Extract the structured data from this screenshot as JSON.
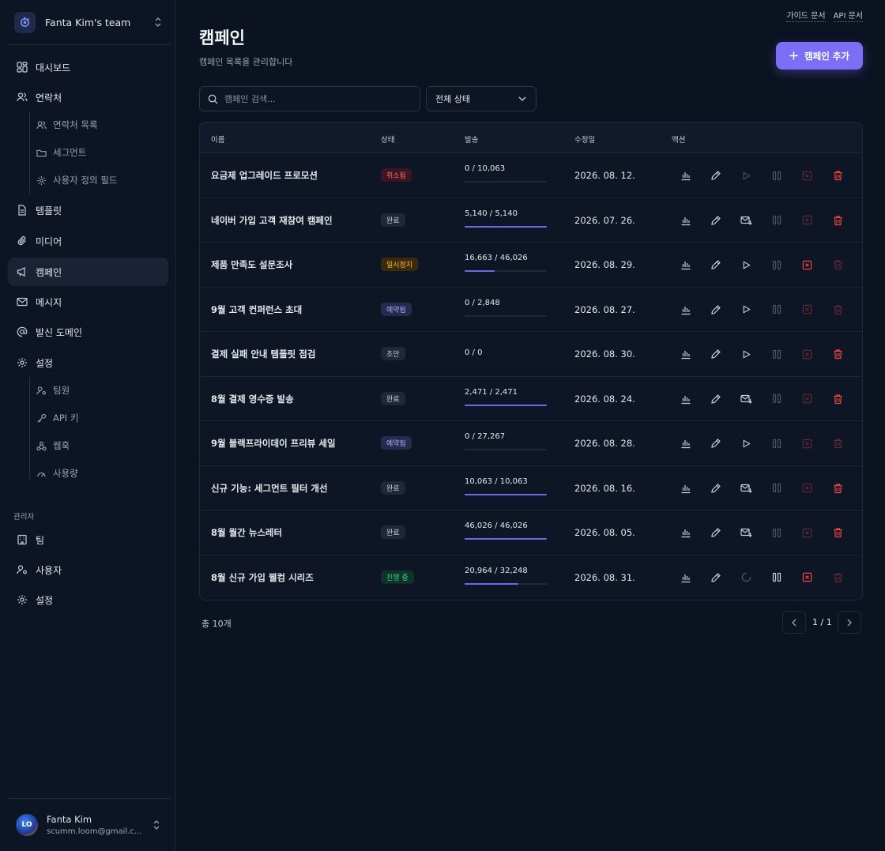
{
  "team": {
    "name": "Fanta Kim's team"
  },
  "nav": {
    "dashboard": "대시보드",
    "contacts": "연락처",
    "contacts_list": "연락처 목록",
    "segments": "세그먼트",
    "custom_fields": "사용자 정의 필드",
    "templates": "템플릿",
    "media": "미디어",
    "campaigns": "캠페인",
    "messages": "메시지",
    "domains": "발신 도메인",
    "settings": "설정",
    "members": "팀원",
    "api_keys": "API 키",
    "webhooks": "웹훅",
    "usage": "사용량"
  },
  "admin": {
    "label": "관리자",
    "teams": "팀",
    "users": "사용자",
    "settings": "설정"
  },
  "user": {
    "name": "Fanta Kim",
    "email": "scumm.loom@gmail.c...",
    "avatar_text": "LO"
  },
  "top_links": {
    "guide": "가이드 문서",
    "api": "API 문서"
  },
  "page": {
    "title": "캠페인",
    "subtitle": "캠페인 목록을 관리합니다",
    "add_button": "캠페인 추가"
  },
  "search": {
    "placeholder": "캠페인 검색..."
  },
  "filter": {
    "selected": "전체 상태"
  },
  "table": {
    "headers": {
      "name": "이름",
      "status": "상태",
      "sent": "발송",
      "modified": "수정일",
      "actions": "액션"
    },
    "rows": [
      {
        "name": "요금제 업그레이드 프로모션",
        "status": "취소됨",
        "status_type": "cancel",
        "sent": "0 / 10,063",
        "progress": 0,
        "date": "2026. 08. 12.",
        "run_icon": "play-icon",
        "run_active": false,
        "pause_active": false,
        "stop_active": false,
        "delete_active": true
      },
      {
        "name": "네이버 가입 고객 재참여 캠페인",
        "status": "완료",
        "status_type": "done",
        "sent": "5,140 / 5,140",
        "progress": 1,
        "date": "2026. 07. 26.",
        "run_icon": "mail-resend-icon",
        "run_active": true,
        "pause_active": false,
        "stop_active": false,
        "delete_active": true
      },
      {
        "name": "제품 만족도 설문조사",
        "status": "일시정지",
        "status_type": "paused",
        "sent": "16,663 / 46,026",
        "progress": 0.362,
        "date": "2026. 08. 29.",
        "run_icon": "play-icon",
        "run_active": true,
        "pause_active": false,
        "stop_active": true,
        "delete_active": false
      },
      {
        "name": "9월 고객 컨퍼런스 초대",
        "status": "예약됨",
        "status_type": "sched",
        "sent": "0 / 2,848",
        "progress": 0,
        "date": "2026. 08. 27.",
        "run_icon": "play-icon",
        "run_active": true,
        "pause_active": false,
        "stop_active": false,
        "delete_active": false
      },
      {
        "name": "결제 실패 안내 템플릿 점검",
        "status": "초안",
        "status_type": "draft",
        "sent": "0 / 0",
        "progress": null,
        "date": "2026. 08. 30.",
        "run_icon": "play-icon",
        "run_active": true,
        "pause_active": false,
        "stop_active": false,
        "delete_active": true
      },
      {
        "name": "8월 결제 영수증 발송",
        "status": "완료",
        "status_type": "done",
        "sent": "2,471 / 2,471",
        "progress": 1,
        "date": "2026. 08. 24.",
        "run_icon": "mail-resend-icon",
        "run_active": true,
        "pause_active": false,
        "stop_active": false,
        "delete_active": true
      },
      {
        "name": "9월 블랙프라이데이 프리뷰 세일",
        "status": "예약됨",
        "status_type": "sched",
        "sent": "0 / 27,267",
        "progress": 0,
        "date": "2026. 08. 28.",
        "run_icon": "play-icon",
        "run_active": true,
        "pause_active": false,
        "stop_active": false,
        "delete_active": false
      },
      {
        "name": "신규 기능: 세그먼트 필터 개선",
        "status": "완료",
        "status_type": "done",
        "sent": "10,063 / 10,063",
        "progress": 1,
        "date": "2026. 08. 16.",
        "run_icon": "mail-resend-icon",
        "run_active": true,
        "pause_active": false,
        "stop_active": false,
        "delete_active": true
      },
      {
        "name": "8월 월간 뉴스레터",
        "status": "완료",
        "status_type": "done",
        "sent": "46,026 / 46,026",
        "progress": 1,
        "date": "2026. 08. 05.",
        "run_icon": "mail-resend-icon",
        "run_active": true,
        "pause_active": false,
        "stop_active": false,
        "delete_active": true
      },
      {
        "name": "8월 신규 가입 웰컴 시리즈",
        "status": "진행 중",
        "status_type": "running",
        "sent": "20,964 / 32,248",
        "progress": 0.65,
        "date": "2026. 08. 31.",
        "run_icon": "spinner-icon",
        "run_active": false,
        "pause_active": true,
        "stop_active": true,
        "delete_active": false
      }
    ]
  },
  "footer": {
    "total": "총 10개",
    "page": "1 / 1"
  }
}
